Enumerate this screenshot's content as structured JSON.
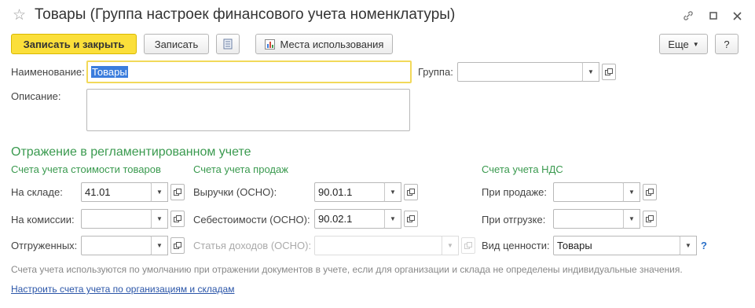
{
  "window": {
    "title": "Товары (Группа настроек финансового учета номенклатуры)"
  },
  "toolbar": {
    "save_close": "Записать и закрыть",
    "save": "Записать",
    "usage": "Места использования",
    "more": "Еще",
    "help": "?"
  },
  "form": {
    "name_label": "Наименование:",
    "name_value": "Товары",
    "group_label": "Группа:",
    "group_value": "",
    "desc_label": "Описание:",
    "desc_value": ""
  },
  "reg": {
    "title": "Отражение в регламентированном учете",
    "cost": {
      "header": "Счета учета стоимости товаров",
      "rows": [
        {
          "label": "На складе:",
          "value": "41.01"
        },
        {
          "label": "На комиссии:",
          "value": ""
        },
        {
          "label": "Отгруженных:",
          "value": ""
        }
      ]
    },
    "sales": {
      "header": "Счета учета продаж",
      "rows": [
        {
          "label": "Выручки (ОСНО):",
          "value": "90.01.1"
        },
        {
          "label": "Себестоимости (ОСНО):",
          "value": "90.02.1"
        },
        {
          "label": "Статья доходов (ОСНО):",
          "value": ""
        }
      ]
    },
    "vat": {
      "header": "Счета учета НДС",
      "rows": [
        {
          "label": "При продаже:",
          "value": ""
        },
        {
          "label": "При отгрузке:",
          "value": ""
        },
        {
          "label": "Вид ценности:",
          "value": "Товары"
        }
      ],
      "help": "?"
    }
  },
  "footer": {
    "note": "Счета учета используются по умолчанию при отражении документов в учете, если для организации и склада не определены индивидуальные значения.",
    "link": "Настроить счета учета по организациям и складам"
  },
  "colors": {
    "accent_yellow": "#fbdf3a",
    "section_green": "#3a9a4f",
    "link_blue": "#2a55a8"
  }
}
